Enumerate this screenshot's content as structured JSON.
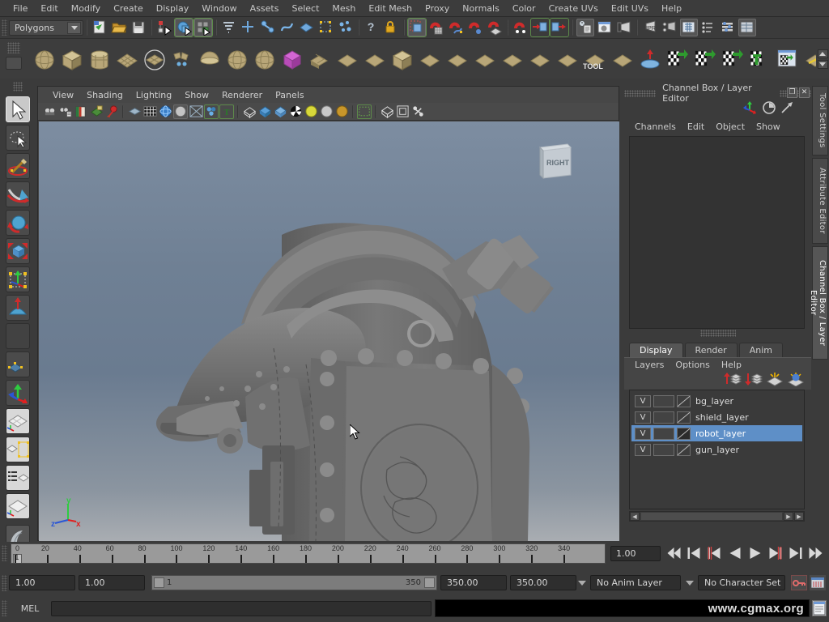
{
  "app": {
    "mode_selector": "Polygons"
  },
  "menubar": {
    "items": [
      "File",
      "Edit",
      "Modify",
      "Create",
      "Display",
      "Window",
      "Assets",
      "Select",
      "Mesh",
      "Edit Mesh",
      "Proxy",
      "Normals",
      "Color",
      "Create UVs",
      "Edit UVs",
      "Help"
    ]
  },
  "viewport": {
    "menus": [
      "View",
      "Shading",
      "Lighting",
      "Show",
      "Renderer",
      "Panels"
    ],
    "viewcube_label": "RIGHT",
    "axis_labels": {
      "x": "x",
      "y": "y",
      "z": "z"
    },
    "background_top": "#7d8da1",
    "background_bottom": "#a9adb2",
    "model_color": "#6f6f6f"
  },
  "channel_box": {
    "title": "Channel Box / Layer Editor",
    "window_buttons": [
      "restore",
      "close"
    ],
    "menus": [
      "Channels",
      "Edit",
      "Object",
      "Show"
    ],
    "icons": [
      "axis-icon",
      "clock-icon",
      "arrow-icon"
    ]
  },
  "layer_editor": {
    "tabs": [
      "Display",
      "Render",
      "Anim"
    ],
    "active_tab": "Display",
    "menus": [
      "Layers",
      "Options",
      "Help"
    ],
    "toolbar_icons": [
      "move-layer-up-icon",
      "move-layer-down-icon",
      "new-layer-icon",
      "new-layer-from-selected-icon"
    ],
    "layers": [
      {
        "visibility": "V",
        "color": "",
        "type": "template",
        "name": "bg_layer",
        "selected": false
      },
      {
        "visibility": "V",
        "color": "",
        "type": "template",
        "name": "shield_layer",
        "selected": false
      },
      {
        "visibility": "V",
        "color": "",
        "type": "reference",
        "name": "robot_layer",
        "selected": true
      },
      {
        "visibility": "V",
        "color": "",
        "type": "template",
        "name": "gun_layer",
        "selected": false
      }
    ],
    "selected_color": "#5e8fc7"
  },
  "side_tabs": {
    "items": [
      "Tool Settings",
      "Attribute Editor",
      "Channel Box / Layer Editor"
    ],
    "active": "Channel Box / Layer Editor"
  },
  "timeline": {
    "ticks": [
      0,
      20,
      40,
      60,
      80,
      100,
      120,
      140,
      160,
      180,
      200,
      220,
      240,
      260,
      280,
      300,
      320,
      340
    ],
    "current_frame_label": "1",
    "current_frame_field": "1.00",
    "playback_buttons": [
      "go-to-start-icon",
      "step-back-keyframe-icon",
      "step-back-frame-icon",
      "play-backwards-icon",
      "play-forwards-icon",
      "step-forward-frame-icon",
      "step-forward-keyframe-icon",
      "go-to-end-icon"
    ]
  },
  "range_slider": {
    "anim_start": "1.00",
    "range_start": "1.00",
    "range_left_label": "1",
    "range_right_label": "350",
    "range_end": "350.00",
    "anim_end": "350.00",
    "anim_layer": "No Anim Layer",
    "character_set": "No Character Set",
    "buttons": [
      "auto-keyframe-icon",
      "animation-preferences-icon"
    ]
  },
  "command_line": {
    "label": "MEL",
    "input_value": "",
    "output_text": "www.cgmax.org"
  },
  "toolbox": {
    "tools": [
      {
        "name": "select-tool",
        "selected": true
      },
      {
        "name": "lasso-select-tool",
        "selected": false
      },
      {
        "name": "paint-select-tool",
        "selected": false
      },
      {
        "name": "move-tool",
        "selected": false
      },
      {
        "name": "rotate-tool",
        "selected": false
      },
      {
        "name": "scale-tool",
        "selected": false
      },
      {
        "name": "universal-manipulator-tool",
        "selected": false
      },
      {
        "name": "soft-modification-tool",
        "selected": false
      },
      {
        "name": "show-manipulator-tool",
        "selected": false
      },
      {
        "name": "last-tool-used",
        "selected": false
      },
      {
        "name": "single-perspective-view-layout",
        "selected": true
      },
      {
        "name": "four-view-layout",
        "selected": true
      },
      {
        "name": "outliner-persp-layout",
        "selected": true
      },
      {
        "name": "persp-view-layout",
        "selected": true
      },
      {
        "name": "hotbox-logo",
        "selected": false
      }
    ]
  },
  "status_line_icons": [
    "new-scene-icon",
    "open-scene-icon",
    "save-scene-icon",
    "select-by-hierarchy-icon",
    "select-by-object-type-icon",
    "select-by-component-type-icon",
    "select-mask-icon",
    "handles-icon",
    "pivots-icon",
    "curves-icon",
    "surfaces-icon",
    "deformers-icon",
    "dynamics-icon",
    "question-icon",
    "lock-icon",
    "highlight-selection-icon",
    "snap-to-grid-icon",
    "snap-to-curve-icon",
    "snap-to-point-icon",
    "snap-to-projected-center-icon",
    "snap-to-view-plane-icon",
    "input-connections-icon",
    "output-connections-icon",
    "construction-history-icon",
    "render-current-frame-icon",
    "ipr-render-icon",
    "render-settings-icon",
    "hypershade-icon",
    "render-view-icon",
    "attribute-editor-icon",
    "tool-settings-icon",
    "channel-box-icon"
  ],
  "shelf_icons": [
    "polygon-sphere-icon",
    "polygon-cube-icon",
    "polygon-cylinder-icon",
    "polygon-plane-icon",
    "polygon-torus-icon",
    "polygon-soccer-ball-icon",
    "polygon-hemisphere-icon",
    "polygon-pyramid-icon",
    "polygon-helix-icon",
    "subdiv-proxy-icon",
    "combine-icon",
    "separate-icon",
    "booleans-icon",
    "mirror-geometry-icon",
    "extrude-icon",
    "bevel-icon",
    "split-polygon-tool-icon",
    "insert-edge-loop-icon",
    "merge-vertices-icon",
    "append-to-polygon-icon",
    "cut-faces-icon",
    "smooth-icon",
    "sculpt-geometry-icon",
    "uv-planar-mapping-icon",
    "uv-cylindrical-mapping-icon",
    "uv-spherical-mapping-icon",
    "uv-automatic-mapping-icon",
    "uv-texture-editor-icon",
    "uv-layout-icon"
  ],
  "viewport_toolbar_icons": [
    "select-camera-icon",
    "camera-attributes-icon",
    "bookmarks-icon",
    "image-plane-icon",
    "keyframe-icon",
    "two-d-pan-zoom-icon",
    "grid-icon",
    "film-gate-icon",
    "resolution-gate-icon",
    "gate-mask-icon",
    "field-chart-icon",
    "safe-action-icon",
    "text-icon",
    "wireframe-icon",
    "smooth-shade-all-icon",
    "smooth-shade-selected-icon",
    "flat-shade-icon",
    "shaded-textured-icon",
    "use-default-lighting-icon",
    "use-all-lights-icon",
    "shadows-icon",
    "xray-icon",
    "xray-joints-icon",
    "isolate-select-icon",
    "no-antialiasing-icon",
    "multisample-icon",
    "screen-space-ao-icon",
    "motion-blur-icon"
  ]
}
